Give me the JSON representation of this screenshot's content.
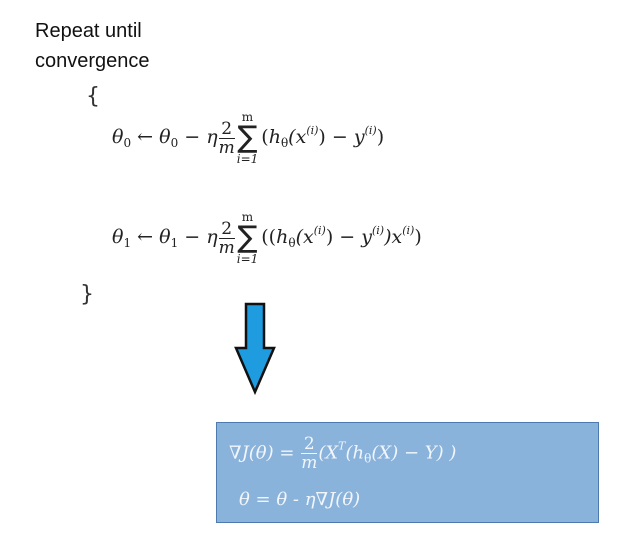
{
  "intro": {
    "line1": "Repeat until",
    "line2": "convergence"
  },
  "braces": {
    "open": "{",
    "close": "}"
  },
  "update_theta0": {
    "lhs": "θ",
    "lhs_sub": "0",
    "arrow": "←",
    "rhs_var": "θ",
    "rhs_sub": "0",
    "minus": "−",
    "rate": "η",
    "frac_num": "2",
    "frac_den": "m",
    "sum_upper": "m",
    "sum_symbol": "∑",
    "sum_lower": "i=1",
    "body_open": "(",
    "h": "h",
    "h_sub": "θ",
    "x": "(x",
    "sup_i": "(i)",
    "close": ")",
    "minus_y": " − y",
    "sup_i2": "(i)",
    "body_close": ")"
  },
  "update_theta1": {
    "lhs": "θ",
    "lhs_sub": "1",
    "arrow": "←",
    "rhs_var": "θ",
    "rhs_sub": "1",
    "minus": "−",
    "rate": "η",
    "frac_num": "2",
    "frac_den": "m",
    "sum_upper": "m",
    "sum_symbol": "∑",
    "sum_lower": "i=1",
    "body_open": "((",
    "h": "h",
    "h_sub": "θ",
    "x": "(x",
    "sup_i": "(i)",
    "close": ")",
    "minus_y": " − y",
    "sup_i2": "(i)",
    "mid_close": ")x",
    "sup_i3": "(i)",
    "body_close": ")"
  },
  "vector_box": {
    "grad_lhs": "∇J(θ) = ",
    "frac_num": "2",
    "frac_den": "m",
    "grad_open": "(X",
    "sup_T": "T",
    "grad_body": "(h",
    "h_sub": "θ",
    "grad_rest": "(X) − Y) )",
    "update": "θ = θ - η∇J(θ)"
  },
  "colors": {
    "arrow_fill": "#1f9be0",
    "arrow_stroke": "#111111",
    "box_fill": "#8ab3dc",
    "box_border": "#4d7bb0"
  },
  "icons": {
    "down_arrow": "down-arrow-icon"
  }
}
